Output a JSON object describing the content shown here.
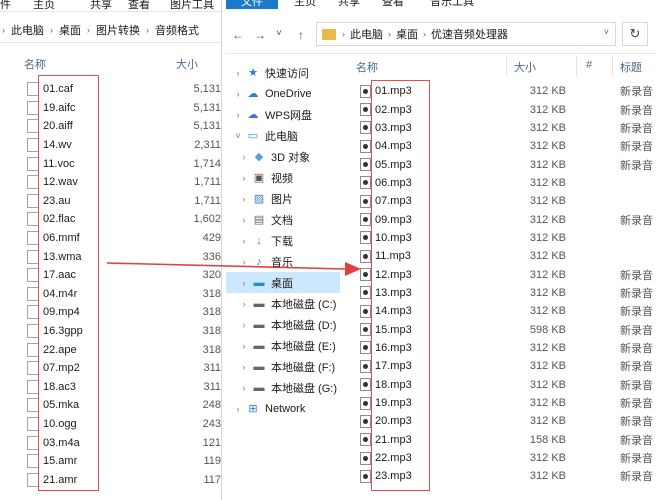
{
  "left_window": {
    "ribbon": [
      "件",
      "主页",
      "共享",
      "查看",
      "图片工具"
    ],
    "breadcrumb": [
      "此电脑",
      "桌面",
      "图片转换",
      "音频格式"
    ],
    "columns": {
      "name": "名称",
      "size": "大小"
    },
    "files": [
      {
        "name": "01.caf",
        "size": "5,131"
      },
      {
        "name": "19.aifc",
        "size": "5,131"
      },
      {
        "name": "20.aiff",
        "size": "5,131"
      },
      {
        "name": "14.wv",
        "size": "2,311"
      },
      {
        "name": "11.voc",
        "size": "1,714"
      },
      {
        "name": "12.wav",
        "size": "1,711"
      },
      {
        "name": "23.au",
        "size": "1,711"
      },
      {
        "name": "02.flac",
        "size": "1,602"
      },
      {
        "name": "06.mmf",
        "size": "429"
      },
      {
        "name": "13.wma",
        "size": "336"
      },
      {
        "name": "17.aac",
        "size": "320"
      },
      {
        "name": "04.m4r",
        "size": "318"
      },
      {
        "name": "09.mp4",
        "size": "318"
      },
      {
        "name": "16.3gpp",
        "size": "318"
      },
      {
        "name": "22.ape",
        "size": "318"
      },
      {
        "name": "07.mp2",
        "size": "311"
      },
      {
        "name": "18.ac3",
        "size": "311"
      },
      {
        "name": "05.mka",
        "size": "248"
      },
      {
        "name": "10.ogg",
        "size": "243"
      },
      {
        "name": "03.m4a",
        "size": "121"
      },
      {
        "name": "15.amr",
        "size": "119"
      },
      {
        "name": "21.amr",
        "size": "117"
      }
    ]
  },
  "right_window": {
    "ribbon": {
      "file": "文件",
      "tabs": [
        "主页",
        "共享",
        "查看",
        "音乐工具"
      ]
    },
    "breadcrumb": [
      "此电脑",
      "桌面",
      "优速音频处理器"
    ],
    "nav_buttons": {
      "back": "←",
      "forward": "→",
      "recent": "˅",
      "up": "↑",
      "refresh": "↻"
    },
    "nav_pane": [
      {
        "label": "快速访问",
        "icon": "star-icon",
        "indent": 0,
        "chev": "›"
      },
      {
        "label": "OneDrive",
        "icon": "cloud-icon",
        "indent": 0,
        "chev": "›"
      },
      {
        "label": "WPS网盘",
        "icon": "wps-cloud-icon",
        "indent": 0,
        "chev": "›"
      },
      {
        "label": "此电脑",
        "icon": "computer-icon",
        "indent": 0,
        "chev": "˅"
      },
      {
        "label": "3D 对象",
        "icon": "cube-icon",
        "indent": 1,
        "chev": "›"
      },
      {
        "label": "视频",
        "icon": "video-icon",
        "indent": 1,
        "chev": "›"
      },
      {
        "label": "图片",
        "icon": "picture-icon",
        "indent": 1,
        "chev": "›"
      },
      {
        "label": "文档",
        "icon": "document-icon",
        "indent": 1,
        "chev": "›"
      },
      {
        "label": "下载",
        "icon": "download-icon",
        "indent": 1,
        "chev": "›"
      },
      {
        "label": "音乐",
        "icon": "music-icon",
        "indent": 1,
        "chev": "›"
      },
      {
        "label": "桌面",
        "icon": "desktop-icon",
        "indent": 1,
        "chev": "›",
        "selected": true
      },
      {
        "label": "本地磁盘 (C:)",
        "icon": "drive-icon",
        "indent": 1,
        "chev": "›"
      },
      {
        "label": "本地磁盘 (D:)",
        "icon": "drive-icon",
        "indent": 1,
        "chev": "›"
      },
      {
        "label": "本地磁盘 (E:)",
        "icon": "drive-icon",
        "indent": 1,
        "chev": "›"
      },
      {
        "label": "本地磁盘 (F:)",
        "icon": "drive-icon",
        "indent": 1,
        "chev": "›"
      },
      {
        "label": "本地磁盘 (G:)",
        "icon": "drive-icon",
        "indent": 1,
        "chev": "›"
      },
      {
        "label": "Network",
        "icon": "network-icon",
        "indent": 0,
        "chev": "›"
      }
    ],
    "columns": {
      "name": "名称",
      "size": "大小",
      "number": "#",
      "title": "标题"
    },
    "files": [
      {
        "name": "01.mp3",
        "size": "312 KB",
        "title": "新录音"
      },
      {
        "name": "02.mp3",
        "size": "312 KB",
        "title": "新录音"
      },
      {
        "name": "03.mp3",
        "size": "312 KB",
        "title": "新录音"
      },
      {
        "name": "04.mp3",
        "size": "312 KB",
        "title": "新录音"
      },
      {
        "name": "05.mp3",
        "size": "312 KB",
        "title": "新录音"
      },
      {
        "name": "06.mp3",
        "size": "312 KB",
        "title": ""
      },
      {
        "name": "07.mp3",
        "size": "312 KB",
        "title": ""
      },
      {
        "name": "09.mp3",
        "size": "312 KB",
        "title": "新录音"
      },
      {
        "name": "10.mp3",
        "size": "312 KB",
        "title": ""
      },
      {
        "name": "11.mp3",
        "size": "312 KB",
        "title": ""
      },
      {
        "name": "12.mp3",
        "size": "312 KB",
        "title": "新录音"
      },
      {
        "name": "13.mp3",
        "size": "312 KB",
        "title": "新录音"
      },
      {
        "name": "14.mp3",
        "size": "312 KB",
        "title": "新录音"
      },
      {
        "name": "15.mp3",
        "size": "598 KB",
        "title": "新录音"
      },
      {
        "name": "16.mp3",
        "size": "312 KB",
        "title": "新录音"
      },
      {
        "name": "17.mp3",
        "size": "312 KB",
        "title": "新录音"
      },
      {
        "name": "18.mp3",
        "size": "312 KB",
        "title": "新录音"
      },
      {
        "name": "19.mp3",
        "size": "312 KB",
        "title": "新录音"
      },
      {
        "name": "20.mp3",
        "size": "312 KB",
        "title": "新录音"
      },
      {
        "name": "21.mp3",
        "size": "158 KB",
        "title": "新录音"
      },
      {
        "name": "22.mp3",
        "size": "312 KB",
        "title": "新录音"
      },
      {
        "name": "23.mp3",
        "size": "312 KB",
        "title": "新录音"
      }
    ]
  },
  "colors": {
    "highlight_box": "#e05050",
    "arrow": "#e04040",
    "selection": "#cce8ff",
    "file_tab": "#1979ca"
  }
}
